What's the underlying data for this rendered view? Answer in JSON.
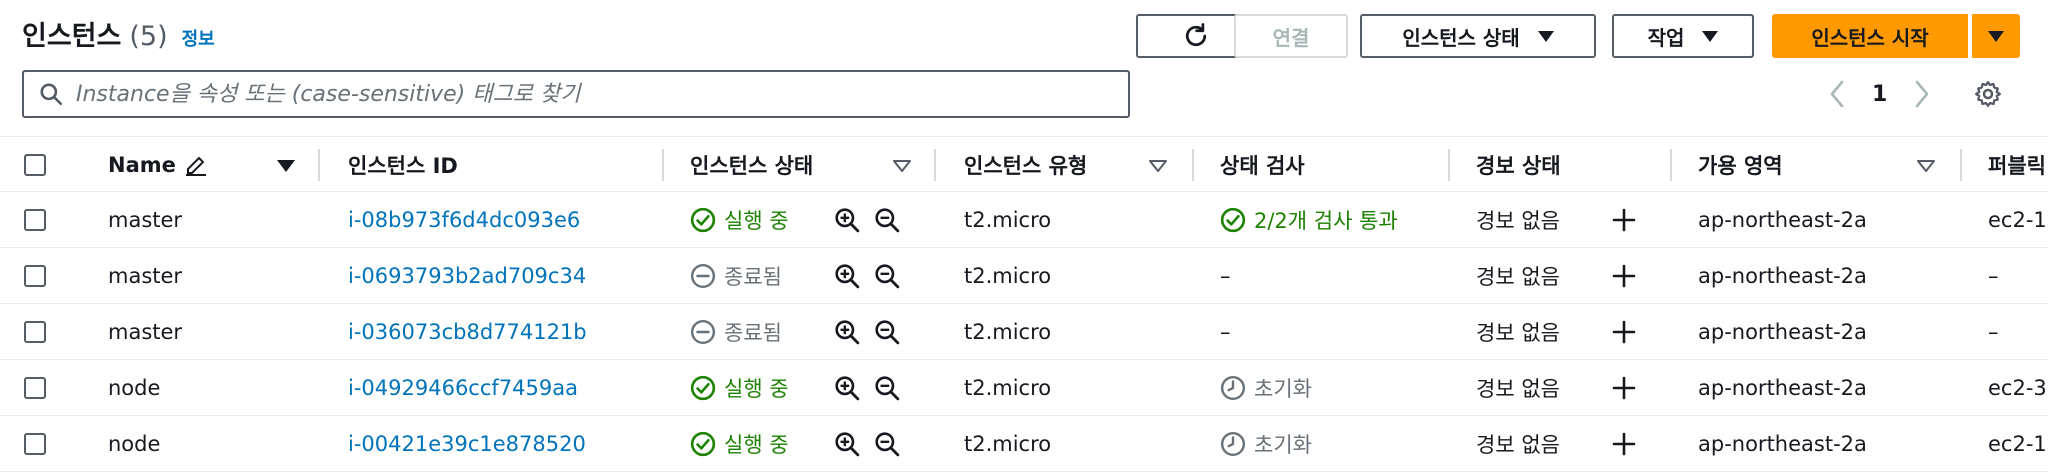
{
  "header": {
    "title": "인스턴스",
    "count": "(5)",
    "info_link": "정보"
  },
  "toolbar": {
    "refresh_icon": "refresh-icon",
    "connect_label": "연결",
    "instance_state_label": "인스턴스 상태",
    "actions_label": "작업",
    "launch_label": "인스턴스 시작"
  },
  "search": {
    "placeholder": "Instance을 속성 또는 (case-sensitive) 태그로 찾기",
    "value": ""
  },
  "pagination": {
    "page": "1"
  },
  "table": {
    "headers": {
      "name": "Name",
      "instance_id": "인스턴스 ID",
      "instance_state": "인스턴스 상태",
      "instance_type": "인스턴스 유형",
      "status_check": "상태 검사",
      "alarm_status": "경보 상태",
      "availability_zone": "가용 영역",
      "public_dns": "퍼블릭"
    },
    "rows": [
      {
        "name": "master",
        "id": "i-08b973f6d4dc093e6",
        "state": "실행 중",
        "state_kind": "running",
        "type": "t2.micro",
        "check": "2/2개 검사 통과",
        "check_kind": "passed",
        "alarm": "경보 없음",
        "az": "ap-northeast-2a",
        "dns": "ec2-1"
      },
      {
        "name": "master",
        "id": "i-0693793b2ad709c34",
        "state": "종료됨",
        "state_kind": "terminated",
        "type": "t2.micro",
        "check": "–",
        "check_kind": "none",
        "alarm": "경보 없음",
        "az": "ap-northeast-2a",
        "dns": "–"
      },
      {
        "name": "master",
        "id": "i-036073cb8d774121b",
        "state": "종료됨",
        "state_kind": "terminated",
        "type": "t2.micro",
        "check": "–",
        "check_kind": "none",
        "alarm": "경보 없음",
        "az": "ap-northeast-2a",
        "dns": "–"
      },
      {
        "name": "node",
        "id": "i-04929466ccf7459aa",
        "state": "실행 중",
        "state_kind": "running",
        "type": "t2.micro",
        "check": "초기화",
        "check_kind": "initializing",
        "alarm": "경보 없음",
        "az": "ap-northeast-2a",
        "dns": "ec2-3"
      },
      {
        "name": "node",
        "id": "i-00421e39c1e878520",
        "state": "실행 중",
        "state_kind": "running",
        "type": "t2.micro",
        "check": "초기화",
        "check_kind": "initializing",
        "alarm": "경보 없음",
        "az": "ap-northeast-2a",
        "dns": "ec2-1"
      }
    ]
  },
  "colors": {
    "primary": "#ff9900",
    "link": "#0073bb",
    "success": "#1d8102",
    "muted": "#687078"
  }
}
